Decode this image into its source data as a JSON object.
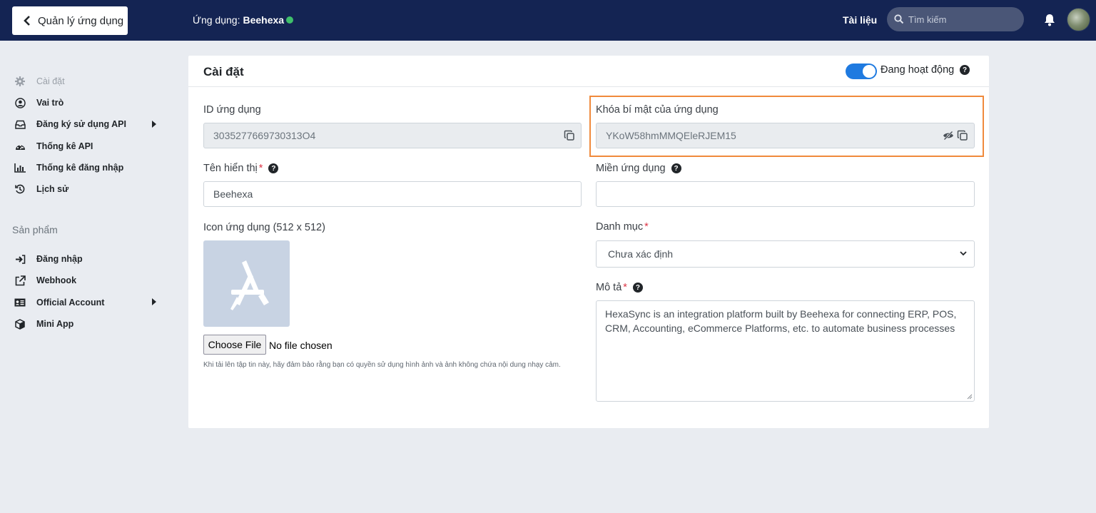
{
  "topbar": {
    "back_label": "Quản lý ứng dụng",
    "app_prefix": "Ứng dụng:",
    "app_name": "Beehexa",
    "status_color": "#3fbf6b",
    "docs_label": "Tài liệu",
    "search_placeholder": "Tìm kiếm"
  },
  "sidebar": {
    "items": [
      {
        "label": "Cài đặt",
        "icon": "gear-icon"
      },
      {
        "label": "Vai trò",
        "icon": "user-circle-icon"
      },
      {
        "label": "Đăng ký sử dụng API",
        "icon": "inbox-icon"
      },
      {
        "label": "Thống kê API",
        "icon": "gauge-icon"
      },
      {
        "label": "Thống kê đăng nhập",
        "icon": "bar-chart-icon"
      },
      {
        "label": "Lịch sử",
        "icon": "history-icon"
      }
    ],
    "section_label": "Sản phẩm",
    "product_items": [
      {
        "label": "Đăng nhập",
        "icon": "sign-in-icon"
      },
      {
        "label": "Webhook",
        "icon": "external-link-icon"
      },
      {
        "label": "Official Account",
        "icon": "id-card-icon"
      },
      {
        "label": "Mini App",
        "icon": "cube-icon"
      }
    ]
  },
  "card": {
    "title": "Cài đặt",
    "status_label": "Đang hoạt động",
    "accent_color": "#1f7ae0"
  },
  "form": {
    "app_id_label": "ID ứng dụng",
    "app_id_value": "3035277669730313O4",
    "secret_label": "Khóa bí mật của ứng dụng",
    "secret_value": "YKoW58hmMMQEleRJEM15",
    "display_name_label": "Tên hiển thị",
    "display_name_value": "Beehexa",
    "domain_label": "Miền ứng dụng",
    "domain_value": "",
    "icon_label": "Icon ứng dụng (512 x 512)",
    "category_label": "Danh mục",
    "category_value": "Chưa xác định",
    "description_label": "Mô tả",
    "description_value": "HexaSync is an integration platform built by Beehexa for connecting ERP, POS, CRM, Accounting, eCommerce Platforms, etc. to automate business processes",
    "file_button": "Choose File",
    "file_status": "No file chosen",
    "file_hint": "Khi tải lên tập tin này, hãy đảm bảo rằng bạn có quyền sử dụng hình ảnh và ảnh không chứa nội dung nhạy cảm.",
    "required_mark": "*",
    "highlight_color": "#f08a3c"
  }
}
